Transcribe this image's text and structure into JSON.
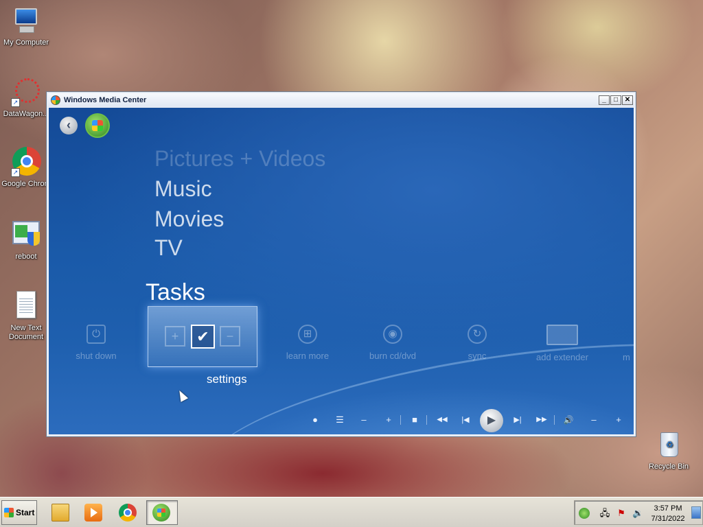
{
  "desktop": {
    "icons": [
      {
        "label": "My Computer"
      },
      {
        "label": "DataWagon..."
      },
      {
        "label": "Google Chrom"
      },
      {
        "label": "reboot"
      },
      {
        "label": "New Text Document"
      },
      {
        "label": "Recycle Bin"
      }
    ]
  },
  "window": {
    "title": "Windows Media Center",
    "controls": {
      "minimize": "_",
      "maximize": "□",
      "close": "✕"
    }
  },
  "wmc": {
    "menu": [
      "Pictures + Videos",
      "Music",
      "Movies",
      "TV"
    ],
    "section": "Tasks",
    "tasks": [
      {
        "label": "shut down",
        "icon": "power-icon"
      },
      {
        "label": "settings",
        "icon": "checkbox-icon"
      },
      {
        "label": "learn more",
        "icon": "windows-logo-icon"
      },
      {
        "label": "burn cd/dvd",
        "icon": "disc-icon"
      },
      {
        "label": "sync",
        "icon": "sync-icon"
      },
      {
        "label": "add extender",
        "icon": "extender-icon"
      },
      {
        "label": "m"
      }
    ],
    "settings_selected": "settings"
  },
  "transport": {
    "record": "●",
    "guide": "☰",
    "ch_down": "–",
    "ch_up": "+",
    "stop": "■",
    "rewind": "◀◀",
    "prev": "|◀",
    "play": "▶",
    "next": "▶|",
    "ffwd": "▶▶",
    "mute": "🔊",
    "vol_down": "–",
    "vol_up": "+"
  },
  "taskbar": {
    "start_label": "Start",
    "clock_time": "3:57 PM",
    "clock_date": "7/31/2022"
  }
}
